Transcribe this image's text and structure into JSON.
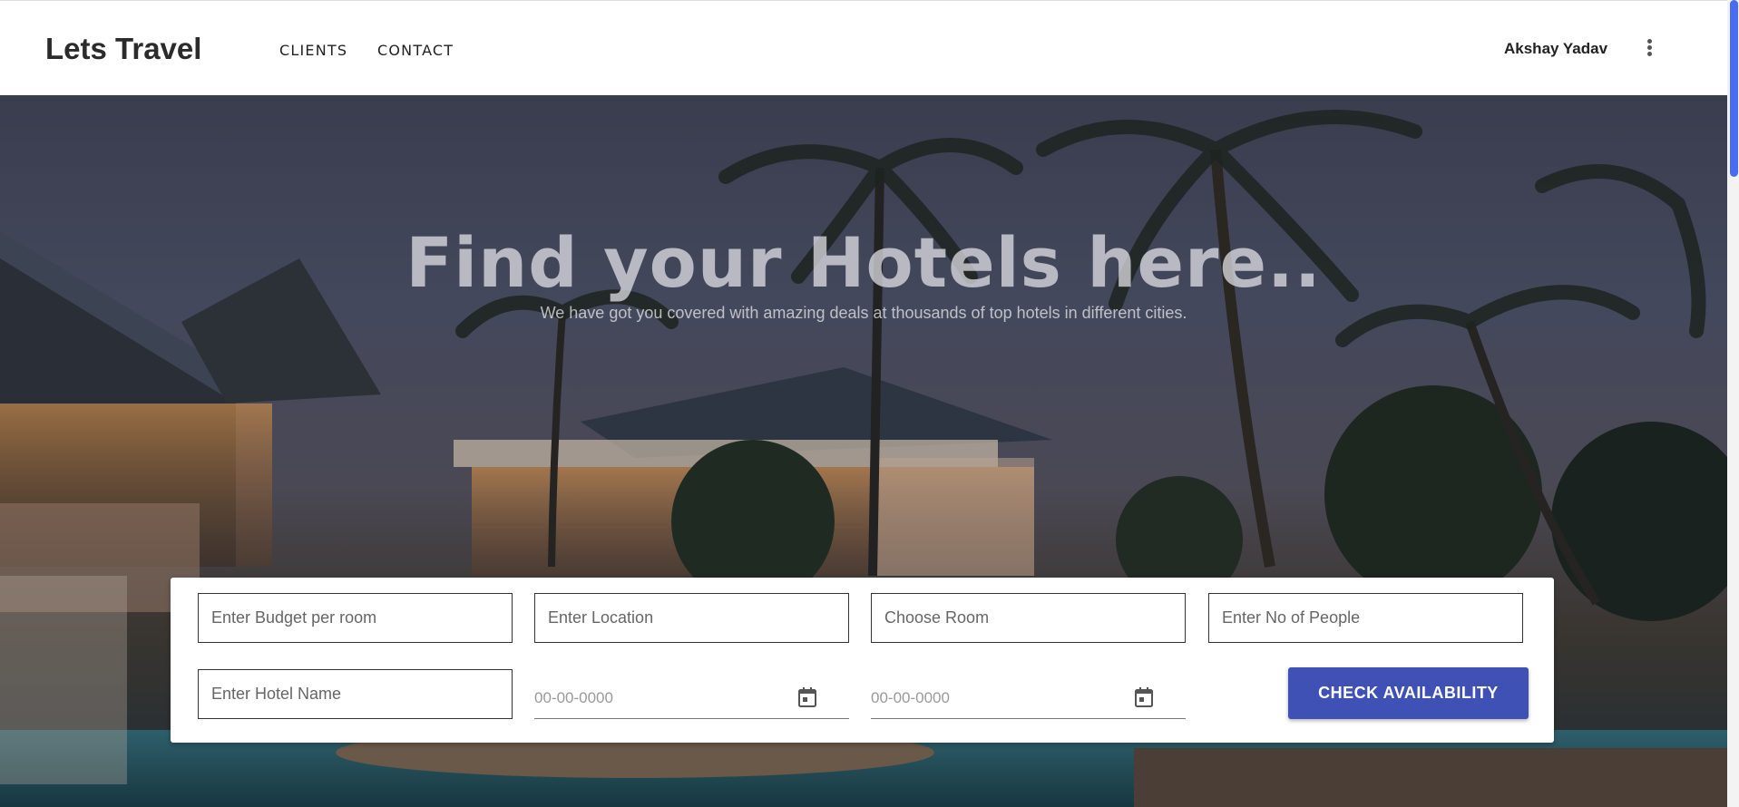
{
  "header": {
    "brand": "Lets Travel",
    "nav": [
      {
        "label": "CLIENTS"
      },
      {
        "label": "CONTACT"
      }
    ],
    "user_name": "Akshay Yadav",
    "menu_icon": "more-vert-icon"
  },
  "hero": {
    "title": "Find your Hotels here..",
    "subtitle": "We have got you covered with amazing deals at thousands of top hotels in different cities."
  },
  "search": {
    "budget_placeholder": "Enter Budget per room",
    "location_placeholder": "Enter Location",
    "room_placeholder": "Choose Room",
    "people_placeholder": "Enter No of People",
    "hotel_placeholder": "Enter Hotel Name",
    "checkin_value": "00-00-0000",
    "checkout_value": "00-00-0000",
    "calendar_icon": "calendar-icon",
    "button_label": "CHECK AVAILABILITY"
  },
  "colors": {
    "accent": "#3f51b5",
    "scrollbar_thumb": "#4a6cf0"
  }
}
